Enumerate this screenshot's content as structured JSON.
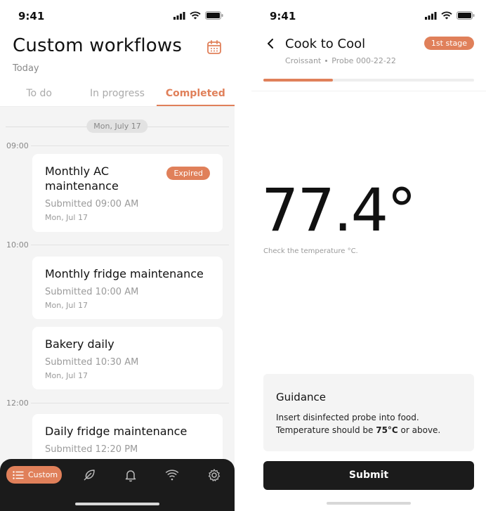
{
  "left": {
    "status_time": "9:41",
    "title": "Custom workflows",
    "subtitle": "Today",
    "tabs": [
      {
        "label": "To do"
      },
      {
        "label": "In progress"
      },
      {
        "label": "Completed"
      }
    ],
    "active_tab": "Completed",
    "date_pill": "Mon, July 17",
    "time_groups": [
      "09:00",
      "10:00",
      "12:00"
    ],
    "cards": [
      {
        "title_line1": "Monthly AC",
        "title_line2": "maintenance",
        "badge": "Expired",
        "submitted": "Submitted 09:00 AM",
        "date": "Mon, Jul 17"
      },
      {
        "title": "Monthly fridge maintenance",
        "submitted": "Submitted 10:00 AM",
        "date": "Mon, Jul 17"
      },
      {
        "title": "Bakery daily",
        "submitted": "Submitted 10:30 AM",
        "date": "Mon, Jul 17"
      },
      {
        "title": "Daily fridge maintenance",
        "submitted": "Submitted 12:20 PM"
      }
    ],
    "nav": {
      "custom_label": "Custom",
      "icons": [
        "list-icon",
        "feather-icon",
        "bell-icon",
        "wifi-icon",
        "gear-icon"
      ]
    }
  },
  "right": {
    "status_time": "9:41",
    "title": "Cook to Cool",
    "stage_badge": "1st stage",
    "meta_item": "Croissant",
    "meta_probe": "Probe 000-22-22",
    "progress_fraction": 0.33,
    "temperature": "77.4°",
    "temperature_hint": "Check the temperature °C.",
    "guidance": {
      "title": "Guidance",
      "line1": "Insert disinfected probe into food.",
      "line2_prefix": "Temperature should be ",
      "line2_bold": "75°C",
      "line2_suffix": " or above."
    },
    "submit_label": "Submit"
  },
  "colors": {
    "accent": "#e0805a",
    "dark": "#1b1b1b",
    "muted": "#9a9a9a"
  }
}
